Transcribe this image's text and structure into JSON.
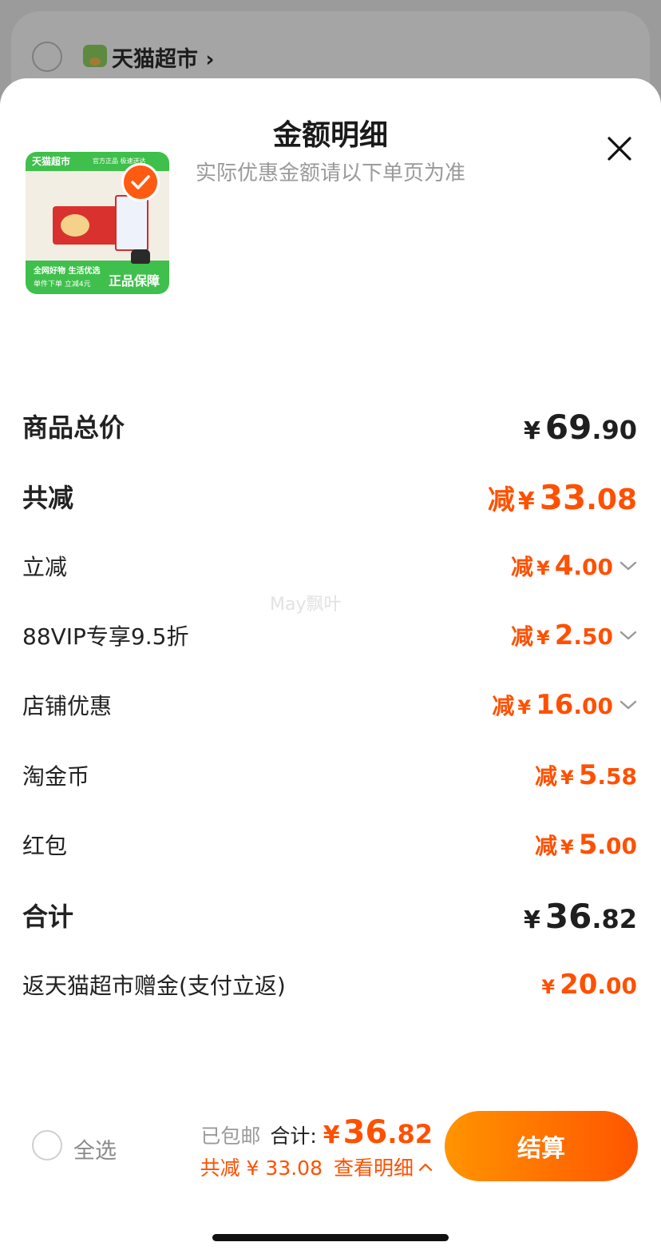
{
  "background": {
    "store_name": "天猫超市 ›"
  },
  "sheet": {
    "title": "金额明细",
    "subtitle": "实际优惠金额请以下单页为准",
    "close_icon": "close-icon"
  },
  "product": {
    "brand_text": "天猫超市",
    "tagline": "官方正品 极速送达",
    "promo_line1": "全网好物 生活优选",
    "promo_line2": "单件下单 立减4元",
    "guarantee": "正品保障",
    "selected": true
  },
  "rows": {
    "total_goods": {
      "label": "商品总价",
      "yen": "¥",
      "int": "69",
      "dec": ".90"
    },
    "total_discount": {
      "label": "共减",
      "prefix": "减",
      "yen": "¥",
      "int": "33",
      "dec": ".08"
    },
    "instant": {
      "label": "立减",
      "prefix": "减",
      "yen": "¥",
      "int": "4",
      "dec": ".00"
    },
    "vip": {
      "label": "88VIP专享9.5折",
      "prefix": "减",
      "yen": "¥",
      "int": "2",
      "dec": ".50"
    },
    "store_coupon": {
      "label": "店铺优惠",
      "prefix": "减",
      "yen": "¥",
      "int": "16",
      "dec": ".00"
    },
    "coins": {
      "label": "淘金币",
      "prefix": "减",
      "yen": "¥",
      "int": "5",
      "dec": ".58"
    },
    "red_packet": {
      "label": "红包",
      "prefix": "减",
      "yen": "¥",
      "int": "5",
      "dec": ".00"
    },
    "grand_total": {
      "label": "合计",
      "yen": "¥",
      "int": "36",
      "dec": ".82"
    },
    "cashback": {
      "label": "返天猫超市赠金(支付立返)",
      "yen": "¥",
      "int": "20",
      "dec": ".00"
    }
  },
  "watermark": "May飘叶",
  "footer": {
    "select_all": "全选",
    "shipping": "已包邮",
    "total_label": "合计:",
    "total_yen": "¥",
    "total_int": "36",
    "total_dec": ".82",
    "saved": "共减 ¥ 33.08",
    "details_link": "查看明细",
    "checkout": "结算"
  },
  "colors": {
    "accent": "#ff5000",
    "button_start": "#ff9400",
    "button_end": "#ff5500",
    "product_green": "#3fbf4b"
  }
}
